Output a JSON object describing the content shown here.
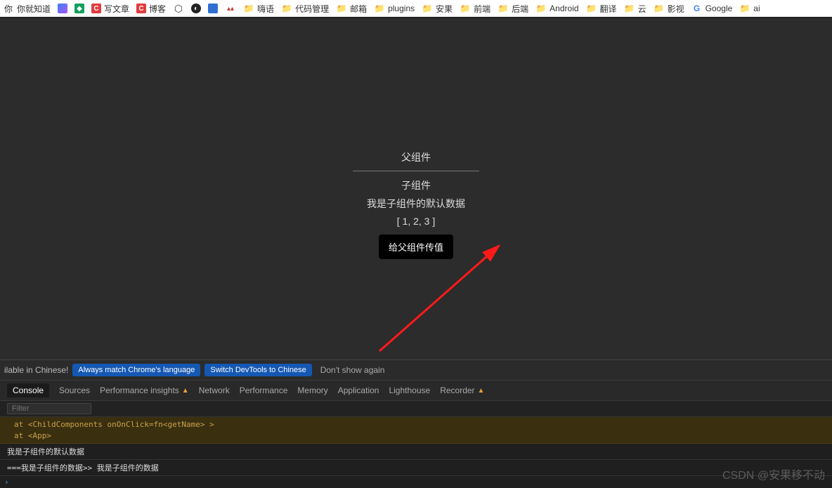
{
  "bookmarks": [
    {
      "label": "你就知道",
      "icon": "grad"
    },
    {
      "label": "",
      "icon": "green"
    },
    {
      "label": "",
      "icon": "red-c",
      "content": "C"
    },
    {
      "label": "写文章",
      "icon": "folder"
    },
    {
      "label": "博客",
      "icon": "red-c",
      "content": "C"
    },
    {
      "label": "",
      "icon": "hex"
    },
    {
      "label": "",
      "icon": "dark"
    },
    {
      "label": "",
      "icon": "blue"
    },
    {
      "label": "",
      "icon": "red-tri"
    },
    {
      "label": "嗨语",
      "icon": "folder"
    },
    {
      "label": "代码管理",
      "icon": "folder"
    },
    {
      "label": "邮箱",
      "icon": "folder"
    },
    {
      "label": "plugins",
      "icon": "folder"
    },
    {
      "label": "安果",
      "icon": "folder"
    },
    {
      "label": "前端",
      "icon": "folder"
    },
    {
      "label": "后端",
      "icon": "folder"
    },
    {
      "label": "Android",
      "icon": "folder"
    },
    {
      "label": "翻译",
      "icon": "folder"
    },
    {
      "label": "云",
      "icon": "folder"
    },
    {
      "label": "影视",
      "icon": "folder"
    },
    {
      "label": "Google",
      "icon": "google"
    },
    {
      "label": "ai",
      "icon": "folder"
    }
  ],
  "demo": {
    "parent_title": "父组件",
    "child_title": "子组件",
    "child_data": "我是子组件的默认数据",
    "child_array": "[ 1, 2, 3 ]",
    "button_label": "给父组件传值"
  },
  "devtools": {
    "banner_prefix": "ilable in Chinese!",
    "btn_match": "Always match Chrome's language",
    "btn_switch": "Switch DevTools to Chinese",
    "btn_dont": "Don't show again",
    "tabs": [
      "Console",
      "Sources",
      "Performance insights",
      "Network",
      "Performance",
      "Memory",
      "Application",
      "Lighthouse",
      "Recorder"
    ],
    "filter_placeholder": "Filter",
    "warn_line1": "at <ChildComponents onOnClick=fn<getName> >",
    "warn_line2": "at <App>",
    "log1": "我是子组件的默认数据",
    "log2": "===我是子组件的数据>> 我是子组件的数据"
  },
  "watermark": "CSDN @安果移不动"
}
